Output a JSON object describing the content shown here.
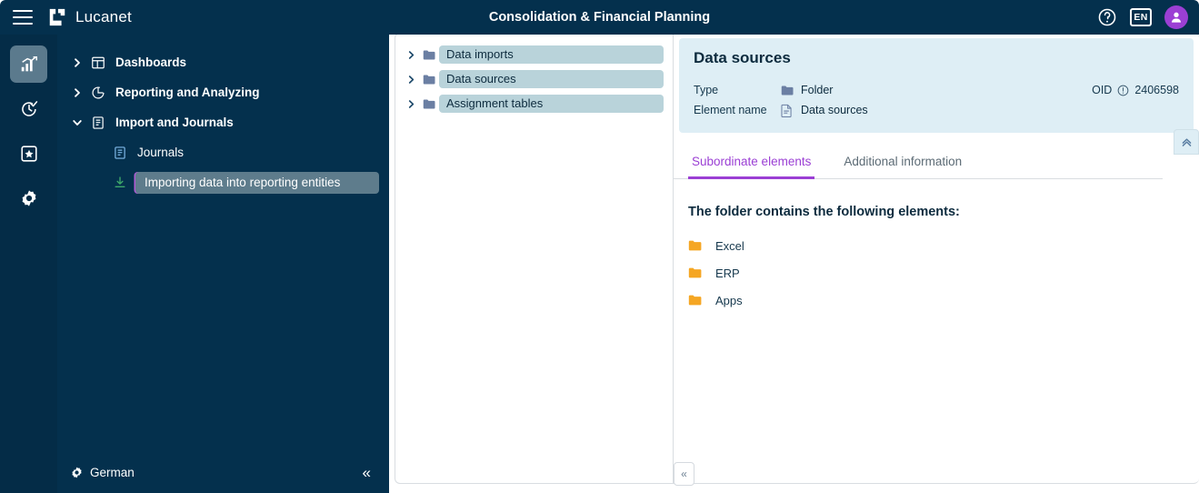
{
  "topbar": {
    "menu_icon": "hamburger-icon",
    "brand": "Lucanet",
    "title": "Consolidation & Financial Planning",
    "help_icon": "help-circle-icon",
    "language_code": "EN",
    "avatar_icon": "user-avatar-icon"
  },
  "rail": {
    "items": [
      {
        "icon": "bar-chart-icon",
        "name": "analysis",
        "active": true
      },
      {
        "icon": "clock-check-icon",
        "name": "planning",
        "active": false
      },
      {
        "icon": "box-star-icon",
        "name": "modeling",
        "active": false
      },
      {
        "icon": "gear-icon",
        "name": "settings",
        "active": false
      }
    ]
  },
  "sidebar": {
    "items": [
      {
        "label": "Dashboards",
        "icon": "dashboard-icon",
        "caret": "chevron-right",
        "level": 0,
        "selected": false
      },
      {
        "label": "Reporting and Analyzing",
        "icon": "pie-chart-icon",
        "caret": "chevron-right",
        "level": 0,
        "selected": false
      },
      {
        "label": "Import and Journals",
        "icon": "journal-icon",
        "caret": "chevron-down",
        "level": 0,
        "selected": false
      },
      {
        "label": "Journals",
        "icon": "journal-icon",
        "caret": "",
        "level": 1,
        "selected": false
      },
      {
        "label": "Importing data into reporting entities",
        "icon": "import-arrow-icon",
        "caret": "",
        "level": 1,
        "selected": true
      }
    ],
    "footer": {
      "gear_icon": "gear-icon",
      "language": "German",
      "collapse_label": "«"
    }
  },
  "tree": {
    "items": [
      {
        "label": "Data imports",
        "icon": "folder-icon",
        "caret": "chevron-right"
      },
      {
        "label": "Data sources",
        "icon": "folder-icon",
        "caret": "chevron-right"
      },
      {
        "label": "Assignment tables",
        "icon": "folder-icon",
        "caret": "chevron-right"
      }
    ],
    "collapse_label": "«"
  },
  "detail": {
    "title": "Data sources",
    "meta": [
      {
        "key": "Type",
        "icon": "folder-icon",
        "value": "Folder"
      },
      {
        "key": "Element name",
        "icon": "document-icon",
        "value": "Data sources"
      }
    ],
    "oid_label": "OID",
    "oid_info_icon": "info-circle-icon",
    "oid_value": "2406598",
    "collapse_up_icon": "chevron-double-up-icon",
    "tabs": [
      {
        "label": "Subordinate elements",
        "active": true
      },
      {
        "label": "Additional information",
        "active": false
      }
    ],
    "body_heading": "The folder contains the following elements:",
    "elements": [
      {
        "label": "Excel",
        "icon": "folder-icon"
      },
      {
        "label": "ERP",
        "icon": "folder-icon"
      },
      {
        "label": "Apps",
        "icon": "folder-icon"
      }
    ]
  },
  "colors": {
    "header_bg": "#04304d",
    "rail_bg": "#042c47",
    "accent_purple": "#9b3fd4",
    "tree_pill": "#b9d3da",
    "detail_head_bg": "#deeef5",
    "folder_orange": "#f5a623",
    "folder_slate": "#6b7fa3"
  }
}
